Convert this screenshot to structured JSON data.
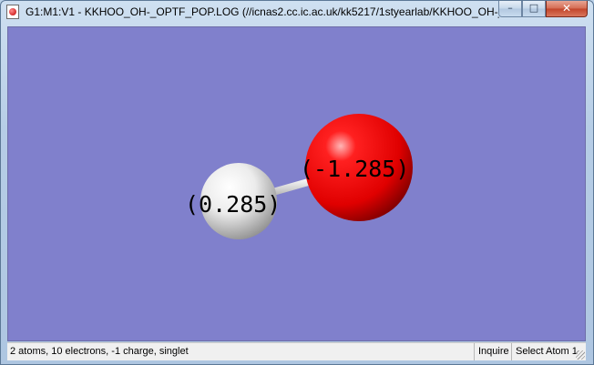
{
  "window": {
    "title": "G1:M1:V1 - KKHOO_OH-_OPTF_POP.LOG (//icnas2.cc.ic.ac.uk/kk5217/1styearlab/KKHOO_OH-_...",
    "controls": {
      "minimize": "–",
      "maximize": "□",
      "close": "✕"
    }
  },
  "viewer": {
    "background_color": "#8080cc",
    "atoms": [
      {
        "element": "H",
        "color": "#ffffff",
        "charge_label": "(0.285)"
      },
      {
        "element": "O",
        "color": "#ff0000",
        "charge_label": "(-1.285)"
      }
    ],
    "bond": {
      "color": "#f2f2f2"
    }
  },
  "statusbar": {
    "summary": "2 atoms, 10 electrons, -1 charge, singlet",
    "mode": "Inquire",
    "action": "Select Atom 1"
  }
}
